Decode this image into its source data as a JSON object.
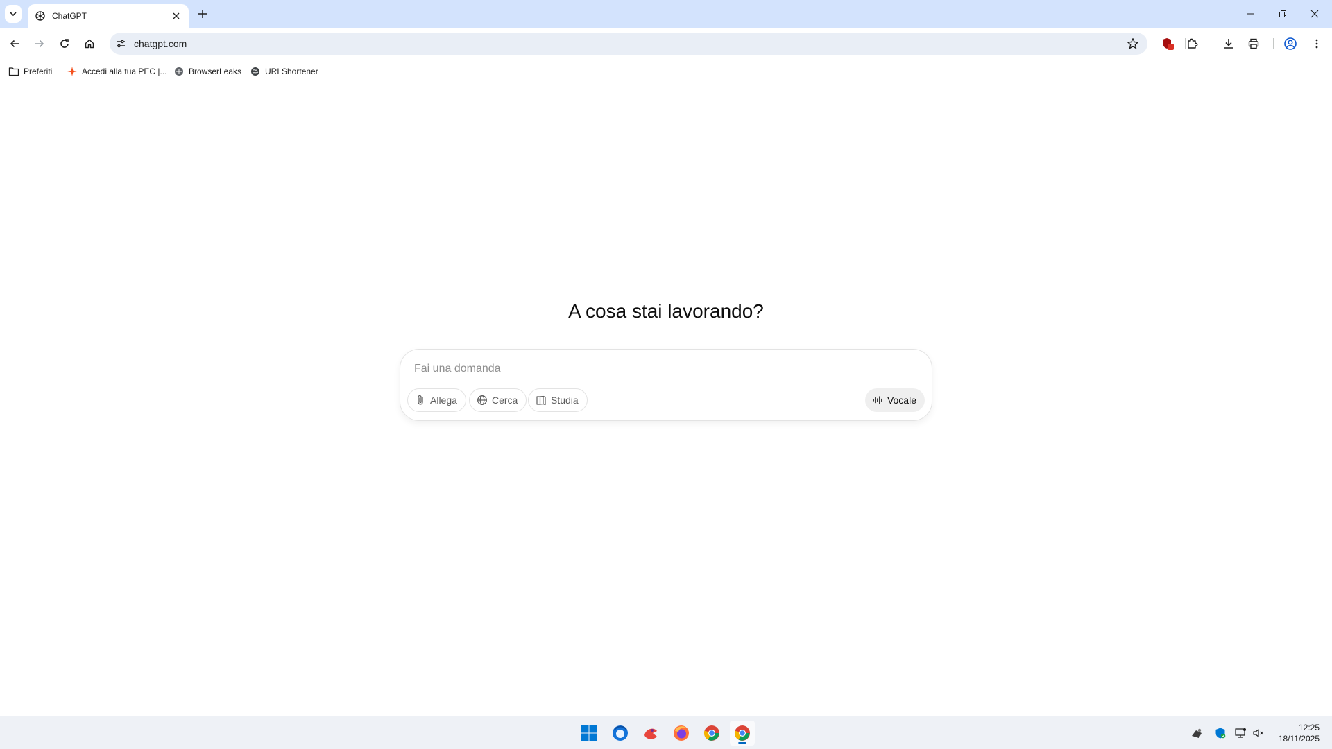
{
  "browser": {
    "tab": {
      "title": "ChatGPT"
    },
    "url": "chatgpt.com",
    "bookmarks": [
      {
        "label": "Preferiti",
        "icon": "folder-icon"
      },
      {
        "label": "Accedi alla tua PEC |...",
        "icon": "sparkle-icon"
      },
      {
        "label": "BrowserLeaks",
        "icon": "browserleaks-icon"
      },
      {
        "label": "URLShortener",
        "icon": "globe-icon"
      }
    ]
  },
  "page": {
    "headline": "A cosa stai lavorando?",
    "composer": {
      "placeholder": "Fai una domanda",
      "chips": [
        {
          "label": "Allega",
          "icon": "paperclip-icon"
        },
        {
          "label": "Cerca",
          "icon": "globe-icon"
        },
        {
          "label": "Studia",
          "icon": "book-icon"
        }
      ],
      "voice_label": "Vocale"
    }
  },
  "taskbar": {
    "time": "12:25",
    "date": "18/11/2025",
    "apps": [
      "windows-start-icon",
      "thunderbird-icon",
      "app-icon",
      "firefox-icon",
      "chrome-icon",
      "chrome-icon"
    ]
  },
  "colors": {
    "tabstrip": "#d3e3fd",
    "omnibox": "#e9eef6",
    "extension_badge": "#d93025"
  }
}
